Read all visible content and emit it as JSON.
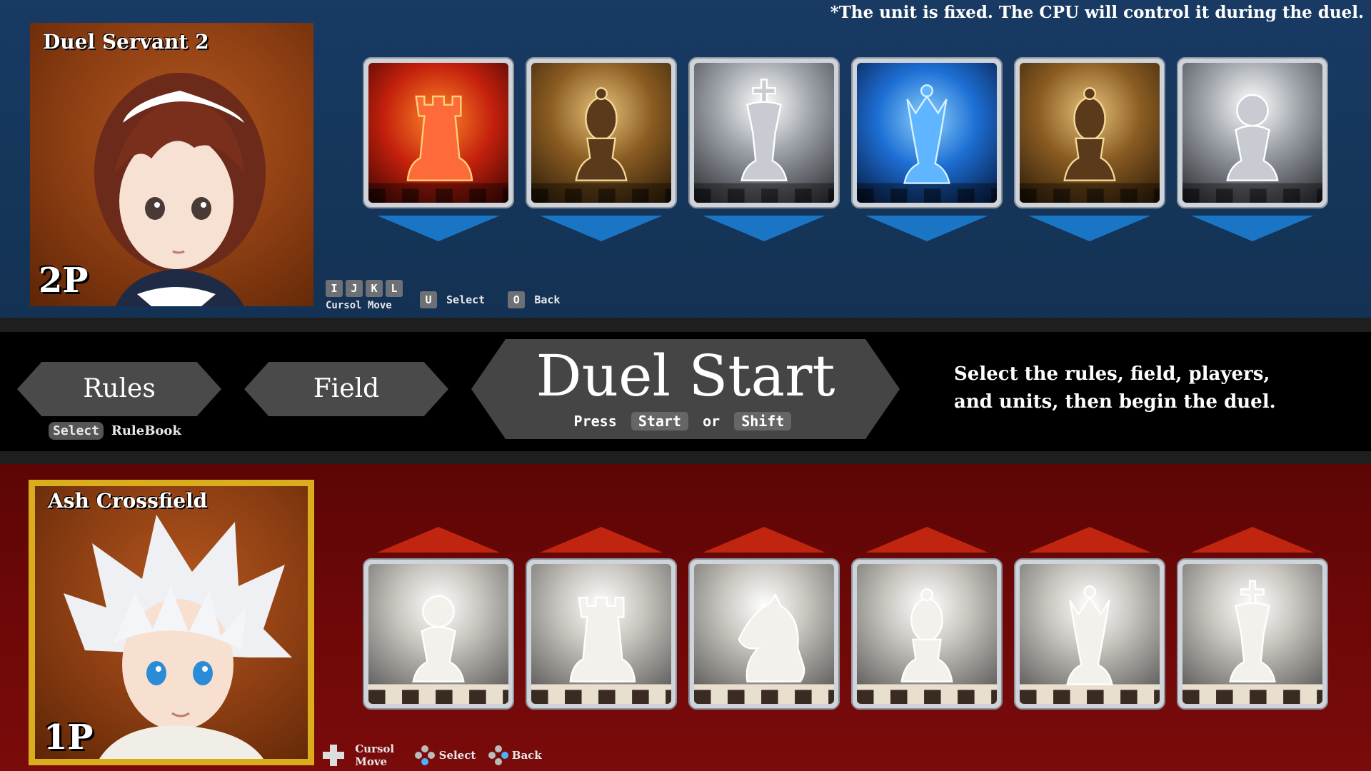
{
  "top": {
    "note": "*The unit is fixed. The CPU will control it during the duel.",
    "player": {
      "name": "Duel Servant 2",
      "tag": "2P"
    },
    "units": [
      {
        "piece": "rook",
        "theme": "fire",
        "color": "#e2401a"
      },
      {
        "piece": "bishop",
        "theme": "gold",
        "color": "#b8862e"
      },
      {
        "piece": "king",
        "theme": "silver",
        "color": "#9aa0a6"
      },
      {
        "piece": "queen",
        "theme": "ice",
        "color": "#2a7fe0"
      },
      {
        "piece": "bishop",
        "theme": "gold",
        "color": "#b8862e"
      },
      {
        "piece": "pawn",
        "theme": "silver",
        "color": "#9aa0a6"
      }
    ],
    "controls": {
      "move_keys": [
        "I",
        "J",
        "K",
        "L"
      ],
      "move_label": "Cursol Move",
      "select_key": "U",
      "select_label": "Select",
      "back_key": "O",
      "back_label": "Back"
    }
  },
  "mid": {
    "rules_label": "Rules",
    "field_label": "Field",
    "rulebook_key": "Select",
    "rulebook_label": "RuleBook",
    "start_title": "Duel Start",
    "press_label": "Press",
    "start_key": "Start",
    "or_label": "or",
    "shift_key": "Shift",
    "description_line1": "Select the rules, field, players,",
    "description_line2": "and units, then begin the duel."
  },
  "bottom": {
    "player": {
      "name": "Ash Crossfield",
      "tag": "1P"
    },
    "units": [
      {
        "piece": "pawn"
      },
      {
        "piece": "rook"
      },
      {
        "piece": "knight"
      },
      {
        "piece": "bishop"
      },
      {
        "piece": "queen"
      },
      {
        "piece": "king"
      }
    ],
    "controls": {
      "move_label_1": "Cursol",
      "move_label_2": "Move",
      "select_label": "Select",
      "back_label": "Back"
    }
  },
  "colors": {
    "top_bg": "#183a63",
    "bottom_bg": "#6e0808",
    "top_arrow": "#1a75c4",
    "bottom_arrow": "#c0250f",
    "p1_frame": "#d9ad1c"
  }
}
